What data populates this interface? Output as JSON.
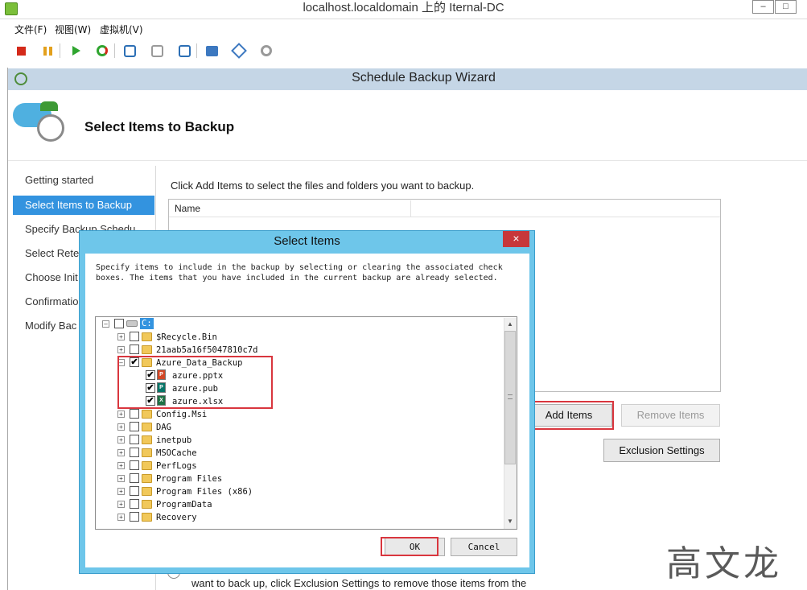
{
  "window": {
    "title": "localhost.localdomain 上的 Iternal-DC",
    "minimize": "–",
    "maximize": "□"
  },
  "menu": [
    "文件(F)",
    "视图(W)",
    "虚拟机(V)"
  ],
  "toolbar_icons": [
    "stop-icon",
    "pause-icon",
    "play-icon",
    "reset-icon",
    "snapshot-icon",
    "snapshot-revert-icon",
    "snapshot-manager-icon",
    "send-ctrl-alt-del-icon",
    "network-icon",
    "settings-icon"
  ],
  "wizard": {
    "title": "Schedule Backup Wizard",
    "header": "Select Items to Backup",
    "steps": [
      {
        "label": "Getting started",
        "active": false
      },
      {
        "label": "Select Items to Backup",
        "active": true
      },
      {
        "label": "Specify Backup Schedu",
        "active": false
      },
      {
        "label": "Select Reter",
        "active": false
      },
      {
        "label": "Choose Init",
        "active": false
      },
      {
        "label": "Confirmatio",
        "active": false
      },
      {
        "label": "Modify Bac",
        "active": false
      }
    ],
    "instruction": "Click Add Items to select the files and folders you want to backup.",
    "list_header": "Name",
    "buttons": {
      "add": "Add Items",
      "remove": "Remove Items",
      "exclusion": "Exclusion Settings"
    },
    "bottom_text": "want to back up, click Exclusion Settings to remove those items from the"
  },
  "dialog": {
    "title": "Select Items",
    "close": "×",
    "description": "Specify items to include in the backup by selecting or clearing the associated check boxes. The items that you have included in the current backup are already selected.",
    "root_label": "C:",
    "tree": [
      {
        "label": "$Recycle.Bin",
        "checked": false
      },
      {
        "label": "21aab5a16f5047810c7d",
        "checked": false
      },
      {
        "label": "Azure_Data_Backup",
        "checked": true,
        "expanded": true
      },
      {
        "label": "azure.pptx",
        "checked": true,
        "file": "pptx"
      },
      {
        "label": "azure.pub",
        "checked": true,
        "file": "pub"
      },
      {
        "label": "azure.xlsx",
        "checked": true,
        "file": "xlsx"
      },
      {
        "label": "Config.Msi",
        "checked": false
      },
      {
        "label": "DAG",
        "checked": false
      },
      {
        "label": "inetpub",
        "checked": false
      },
      {
        "label": "MSOCache",
        "checked": false
      },
      {
        "label": "PerfLogs",
        "checked": false
      },
      {
        "label": "Program Files",
        "checked": false
      },
      {
        "label": "Program Files (x86)",
        "checked": false
      },
      {
        "label": "ProgramData",
        "checked": false
      },
      {
        "label": "Recovery",
        "checked": false
      }
    ],
    "ok": "OK",
    "cancel": "Cancel"
  },
  "watermark": "高文龙",
  "colors": {
    "accent_selected": "#3393df",
    "dialog_frame": "#6ec6ea",
    "highlight_box": "#d9363e",
    "close_button": "#c7373a"
  }
}
